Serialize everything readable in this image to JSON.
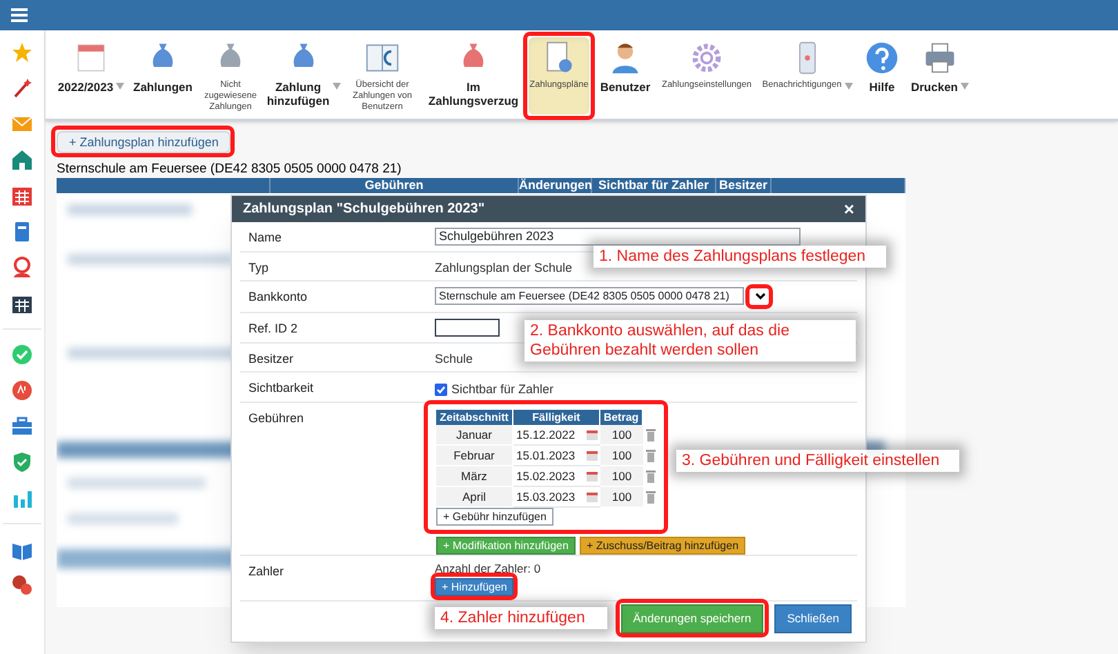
{
  "toolbar": {
    "items": [
      {
        "label": "2022/2023",
        "kind": "large",
        "dropdown": true,
        "selected": false
      },
      {
        "label": "Zahlungen",
        "kind": "large",
        "dropdown": false,
        "selected": false
      },
      {
        "label": "Nicht zugewiesene Zahlungen",
        "kind": "small",
        "dropdown": false,
        "selected": false
      },
      {
        "label": "Zahlung hinzufügen",
        "kind": "large",
        "dropdown": true,
        "selected": false
      },
      {
        "label": "Übersicht der Zahlungen von Benutzern",
        "kind": "small",
        "dropdown": false,
        "selected": false
      },
      {
        "label": "Im Zahlungsverzug",
        "kind": "large",
        "dropdown": false,
        "selected": false
      },
      {
        "label": "Zahlungspläne",
        "kind": "small",
        "dropdown": false,
        "selected": true
      },
      {
        "label": "Benutzer",
        "kind": "large",
        "dropdown": false,
        "selected": false
      },
      {
        "label": "Zahlungseinstellungen",
        "kind": "small",
        "dropdown": false,
        "selected": false
      },
      {
        "label": "Benachrichtigungen",
        "kind": "small",
        "dropdown": true,
        "selected": false
      },
      {
        "label": "Hilfe",
        "kind": "large",
        "dropdown": false,
        "selected": false
      },
      {
        "label": "Drucken",
        "kind": "large",
        "dropdown": true,
        "selected": false
      }
    ]
  },
  "add_plan_button": "+ Zahlungsplan hinzufügen",
  "account_title": "Sternschule am Feuersee (DE42 8305 0505 0000 0478 21)",
  "table": {
    "columns": [
      "",
      "Gebühren",
      "Änderungen",
      "Sichtbar für Zahler",
      "Besitzer",
      ""
    ]
  },
  "dialog": {
    "title": "Zahlungsplan \"Schulgebühren 2023\"",
    "close": "×",
    "rows": [
      {
        "kind": "input",
        "label": "Name",
        "value": "Schulgebühren 2023"
      },
      {
        "kind": "text",
        "label": "Typ",
        "value": "Zahlungsplan der Schule"
      },
      {
        "kind": "select",
        "label": "Bankkonto",
        "value": "Sternschule am Feuersee (DE42 8305 0505 0000 0478 21)"
      },
      {
        "kind": "input_small",
        "label": "Ref. ID 2"
      },
      {
        "kind": "text",
        "label": "Besitzer",
        "value": "Schule"
      },
      {
        "kind": "checkbox",
        "label": "Sichtbarkeit",
        "value": "Sichtbar für Zahler",
        "checked": true
      },
      {
        "kind": "fees",
        "label": "Gebühren"
      },
      {
        "kind": "payers",
        "label": "Zahler",
        "value": "Anzahl der Zahler: 0",
        "button": "+ Hinzufügen"
      }
    ],
    "fees": {
      "columns": [
        "Zeitabschnitt",
        "Fälligkeit",
        "Betrag"
      ],
      "rows": [
        {
          "period": "Januar",
          "due": "15.12.2022",
          "amount": "100"
        },
        {
          "period": "Februar",
          "due": "15.01.2023",
          "amount": "100"
        },
        {
          "period": "März",
          "due": "15.02.2023",
          "amount": "100"
        },
        {
          "period": "April",
          "due": "15.03.2023",
          "amount": "100"
        }
      ],
      "add_button": "+ Gebühr hinzufügen",
      "extra_buttons": [
        {
          "label": "+ Modifikation hinzufügen",
          "kind": "success"
        },
        {
          "label": "+ Zuschuss/Beitrag hinzufügen",
          "kind": "warning"
        }
      ]
    },
    "footer_buttons": [
      {
        "label": "Änderungen speichern",
        "kind": "success"
      },
      {
        "label": "Schließen",
        "kind": "primary"
      }
    ]
  },
  "callouts": [
    "1. Name des Zahlungsplans festlegen",
    "2. Bankkonto auswählen, auf das die Gebühren bezahlt werden sollen",
    "3. Gebühren und Fälligkeit einstellen",
    "4. Zahler hinzufügen"
  ]
}
